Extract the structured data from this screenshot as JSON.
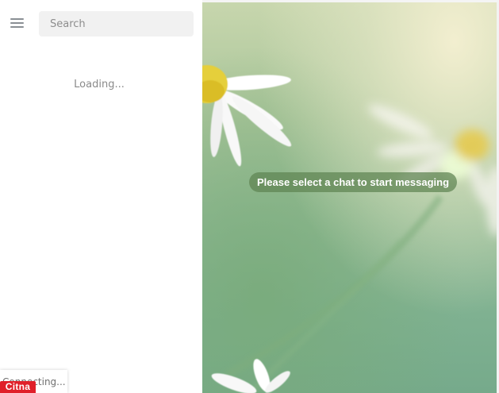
{
  "sidebar": {
    "search": {
      "placeholder": "Search",
      "value": ""
    },
    "loading_text": "Loading..."
  },
  "chat": {
    "empty_message": "Please select a chat to start messaging"
  },
  "status": {
    "connecting_text": "Connecting..."
  },
  "watermark": {
    "logo_text": "Citna"
  },
  "icons": {
    "menu": "hamburger-menu-icon"
  },
  "colors": {
    "pill_background": "#5e8452",
    "logo_red": "#e0202a",
    "search_background": "#f1f1f1"
  }
}
